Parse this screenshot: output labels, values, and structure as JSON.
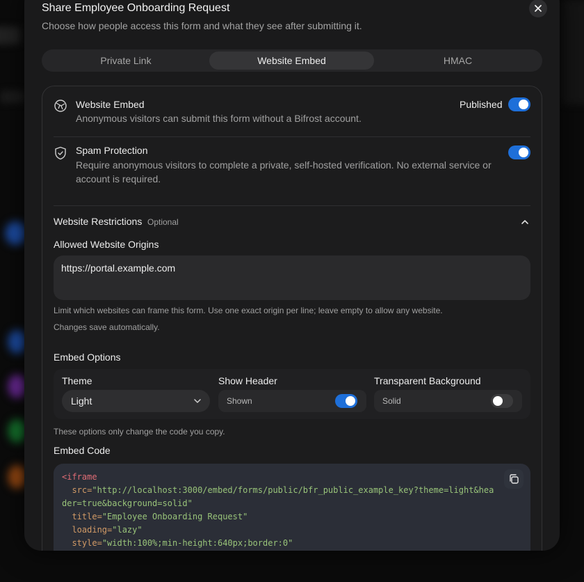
{
  "dialog": {
    "title": "Share Employee Onboarding Request",
    "subtitle": "Choose how people access this form and what they see after submitting it."
  },
  "tabs": [
    {
      "label": "Private Link",
      "active": false
    },
    {
      "label": "Website Embed",
      "active": true
    },
    {
      "label": "HMAC",
      "active": false
    }
  ],
  "website_embed": {
    "title": "Website Embed",
    "description": "Anonymous visitors can submit this form without a Bifrost account.",
    "status_label": "Published",
    "enabled": true
  },
  "spam_protection": {
    "title": "Spam Protection",
    "description_line1": "Require anonymous visitors to complete a private, self-hosted verification. No external service or",
    "description_line2": "account is required.",
    "enabled": true
  },
  "restrictions": {
    "title": "Website Restrictions",
    "optional_label": "Optional",
    "origins_label": "Allowed Website Origins",
    "origins_value": "https://portal.example.com",
    "help_text": "Limit which websites can frame this form. Use one exact origin per line; leave empty to allow any website.",
    "autosave_text": "Changes save automatically."
  },
  "embed_options": {
    "title": "Embed Options",
    "theme_label": "Theme",
    "theme_value": "Light",
    "show_header_label": "Show Header",
    "show_header_value": "Shown",
    "show_header_enabled": true,
    "transparent_label": "Transparent Background",
    "transparent_value": "Solid",
    "transparent_enabled": false,
    "note": "These options only change the code you copy."
  },
  "embed_code": {
    "title": "Embed Code",
    "open_tag": "<iframe",
    "src_attr": "src=",
    "src_line1": "\"http://localhost:3000/embed/forms/public/bfr_public_example_key?theme=light&hea",
    "src_line2": "der=true&background=solid\"",
    "title_attr": "title=",
    "title_value": "\"Employee Onboarding Request\"",
    "loading_attr": "loading=",
    "loading_value": "\"lazy\"",
    "style_attr": "style=",
    "style_value": "\"width:100%;min-height:640px;border:0\""
  },
  "colors": {
    "accent": "#1e6fd9",
    "dialog_bg": "#1a1a1b",
    "code_bg": "#2b2e37"
  }
}
